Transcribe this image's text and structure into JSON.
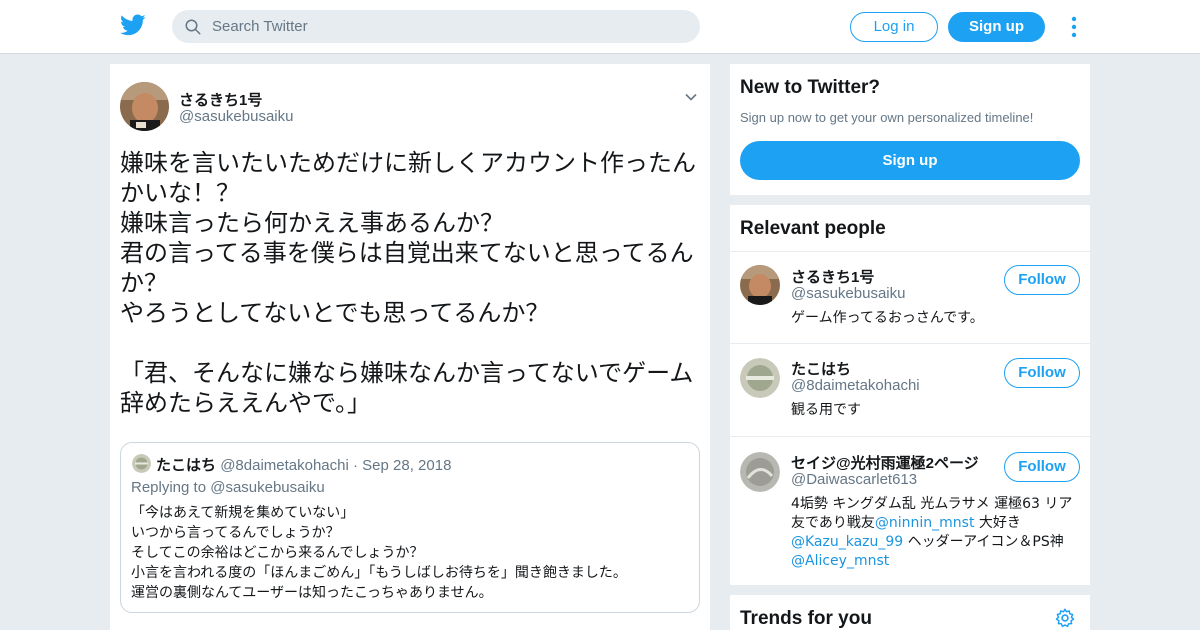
{
  "header": {
    "search_placeholder": "Search Twitter",
    "login_label": "Log in",
    "signup_label": "Sign up"
  },
  "colors": {
    "accent": "#1da1f2",
    "link": "#1b95e0",
    "secondary_text": "#657786",
    "background": "#e6ecf0"
  },
  "icons": [
    "twitter-bird-icon",
    "search-icon",
    "more-dots-icon",
    "chevron-down-icon",
    "gear-icon"
  ],
  "tweet": {
    "author_name": "さるきち1号",
    "author_handle": "@sasukebusaiku",
    "text": "嫌味を言いたいためだけに新しくアカウント作ったんかいな！？\n嫌味言ったら何かええ事あるんか？\n君の言ってる事を僕らは自覚出来てないと思ってるんか？\nやろうとしてないとでも思ってるんか？\n\n「君、そんなに嫌なら嫌味なんか言ってないでゲーム辞めたらええんやで。」",
    "quote": {
      "author_name": "たこはち",
      "author_handle": "@8daimetakohachi",
      "separator": "·",
      "date": "Sep 28, 2018",
      "replying_to": "Replying to @sasukebusaiku",
      "text": "「今はあえて新規を集めていない」\nいつから言ってるんでしょうか？\nそしてこの余裕はどこから来るんでしょうか？\n小言を言われる度の「ほんまごめん」「もうしばしお待ちを」聞き飽きました。\n運営の裏側なんてユーザーは知ったこっちゃありません。"
    }
  },
  "sidebar": {
    "new_to_twitter": {
      "title": "New to Twitter?",
      "subtitle": "Sign up now to get your own personalized timeline!",
      "button_label": "Sign up"
    },
    "relevant_people": {
      "title": "Relevant people",
      "follow_label": "Follow",
      "people": [
        {
          "name": "さるきち1号",
          "handle": "@sasukebusaiku",
          "bio": "ゲーム作ってるおっさんです。"
        },
        {
          "name": "たこはち",
          "handle": "@8daimetakohachi",
          "bio": "観る用です"
        },
        {
          "name": "セイジ@光村雨運極2ページ",
          "handle": "@Daiwascarlet613",
          "bio_part1": "4垢勢 キングダム乱 光ムラサメ 運極63 リア友であり戦友",
          "bio_link1": "@ninnin_mnst",
          "bio_part2": " 大好き ",
          "bio_link2": "@Kazu_kazu_99",
          "bio_part3": " ヘッダーアイコン＆PS神",
          "bio_link3": "@Alicey_mnst"
        }
      ]
    },
    "trends": {
      "title": "Trends for you"
    }
  }
}
